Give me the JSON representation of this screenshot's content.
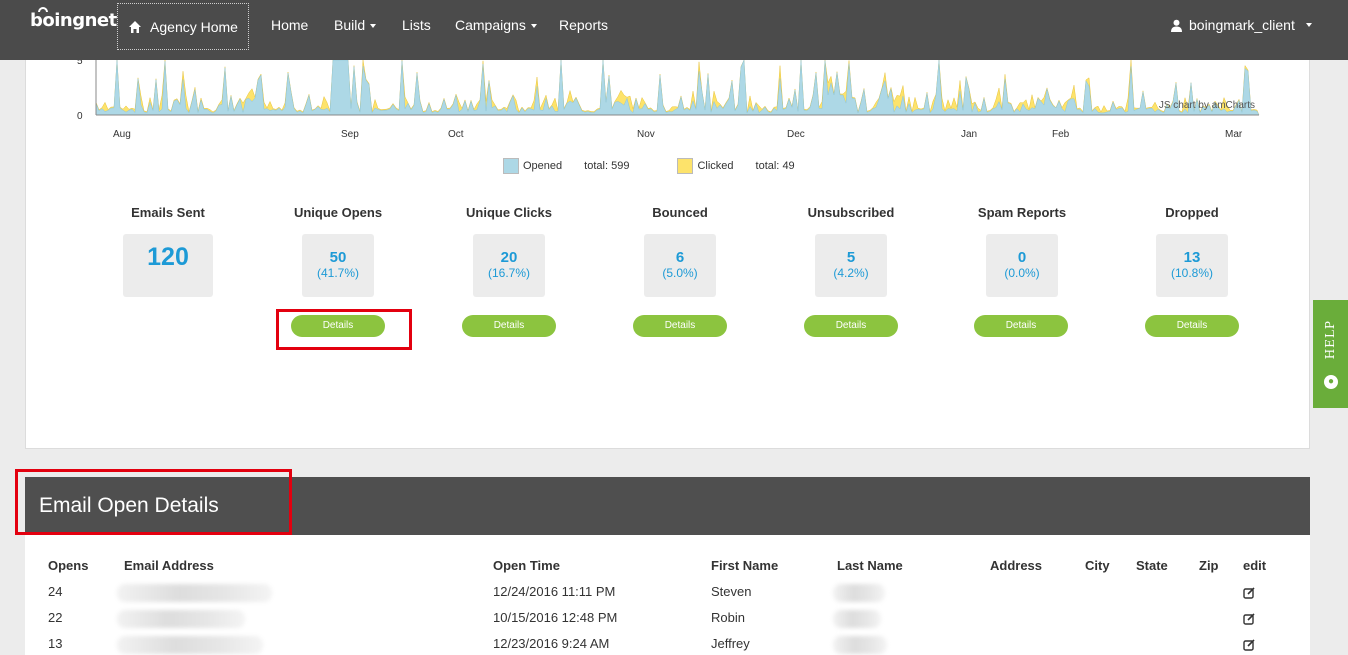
{
  "nav": {
    "logo": "boingnet",
    "agency_home": "Agency Home",
    "items": [
      {
        "label": "Home",
        "dropdown": false
      },
      {
        "label": "Build",
        "dropdown": true
      },
      {
        "label": "Lists",
        "dropdown": false
      },
      {
        "label": "Campaigns",
        "dropdown": true
      },
      {
        "label": "Reports",
        "dropdown": false
      }
    ],
    "user": "boingmark_client"
  },
  "chart_data": {
    "type": "area",
    "ytick_labels": [
      "0",
      "5"
    ],
    "xtick_labels": [
      "Aug",
      "Sep",
      "Oct",
      "Nov",
      "Dec",
      "Jan",
      "Feb",
      "Mar"
    ],
    "series": [
      {
        "name": "Opened",
        "color": "#add8e6"
      },
      {
        "name": "Clicked",
        "color": "#fde36b"
      }
    ],
    "legend": [
      {
        "label": "Opened",
        "total_label": "total:",
        "total": "599"
      },
      {
        "label": "Clicked",
        "total_label": "total:",
        "total": "49"
      }
    ],
    "credit": "JS chart by amCharts"
  },
  "stats": [
    {
      "label": "Emails Sent",
      "value": "120",
      "pct": "",
      "details": ""
    },
    {
      "label": "Unique Opens",
      "value": "50",
      "pct": "(41.7%)",
      "details": "Details"
    },
    {
      "label": "Unique Clicks",
      "value": "20",
      "pct": "(16.7%)",
      "details": "Details"
    },
    {
      "label": "Bounced",
      "value": "6",
      "pct": "(5.0%)",
      "details": "Details"
    },
    {
      "label": "Unsubscribed",
      "value": "5",
      "pct": "(4.2%)",
      "details": "Details"
    },
    {
      "label": "Spam Reports",
      "value": "0",
      "pct": "(0.0%)",
      "details": "Details"
    },
    {
      "label": "Dropped",
      "value": "13",
      "pct": "(10.8%)",
      "details": "Details"
    }
  ],
  "help": "HELP",
  "details_section": {
    "title": "Email Open Details",
    "columns": [
      "Opens",
      "Email Address",
      "Open Time",
      "First Name",
      "Last Name",
      "Address",
      "City",
      "State",
      "Zip",
      "edit"
    ],
    "rows": [
      {
        "opens": "24",
        "open_time": "12/24/2016 11:11 PM",
        "first_name": "Steven"
      },
      {
        "opens": "22",
        "open_time": "10/15/2016 12:48 PM",
        "first_name": "Robin"
      },
      {
        "opens": "13",
        "open_time": "12/23/2016 9:24 AM",
        "first_name": "Jeffrey"
      }
    ]
  },
  "colors": {
    "accent_blue": "#1d9ad6",
    "button_green": "#8cc43f",
    "help_green": "#6aad3a",
    "highlight_red": "#e3000f"
  }
}
